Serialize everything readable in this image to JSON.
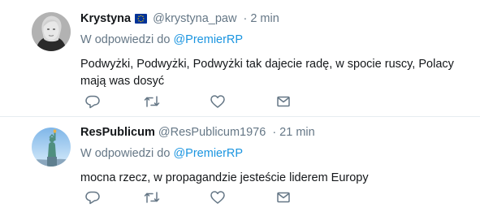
{
  "tweets": [
    {
      "display_name": "Krystyna",
      "flag_icon": "eu-flag-icon",
      "handle": "@krystyna_paw",
      "separator": "·",
      "time": "2 min",
      "reply_prefix": "W odpowiedzi do",
      "reply_to": "@PremierRP",
      "text": "Podwyżki, Podwyżki, Podwyżki tak dajecie radę, w spocie ruscy, Polacy mają was dosyć"
    },
    {
      "display_name": "ResPublicum",
      "handle": "@ResPublicum1976",
      "separator": "·",
      "time": "21 min",
      "reply_prefix": "W odpowiedzi do",
      "reply_to": "@PremierRP",
      "text": "mocna rzecz, w propagandzie jesteście liderem Europy"
    }
  ],
  "icons": {
    "reply": "reply-icon",
    "retweet": "retweet-icon",
    "like": "heart-icon",
    "dm": "envelope-icon"
  },
  "colors": {
    "text_primary": "#14171a",
    "text_secondary": "#657786",
    "link": "#1b95e0",
    "divider": "#e6ecf0",
    "eu_blue": "#003399",
    "eu_yellow": "#ffcc00"
  }
}
